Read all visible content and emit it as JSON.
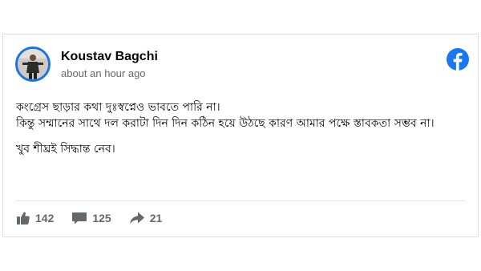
{
  "post": {
    "author": "Koustav Bagchi",
    "time": "about an hour ago",
    "lines": [
      "কংগ্রেস ছাড়ার কথা দুঃস্বপ্নেও ভাবতে পারি না।",
      "কিন্তু সম্মানের সাথে দল করাটা দিন দিন কঠিন হয়ে উঠছে কারণ আমার পক্ষে স্তাবকতা সম্ভব না।"
    ],
    "final_line": "খুব শীঘ্রই সিদ্ধান্ত নেব।"
  },
  "stats": {
    "likes": "142",
    "comments": "125",
    "shares": "21"
  },
  "icons": {
    "brand": "facebook-logo-icon",
    "like": "thumbs-up-icon",
    "comment": "comment-bubble-icon",
    "share": "share-arrow-icon"
  },
  "colors": {
    "brand_blue": "#1877f2",
    "muted_text": "#65676b",
    "primary_text": "#050505"
  }
}
